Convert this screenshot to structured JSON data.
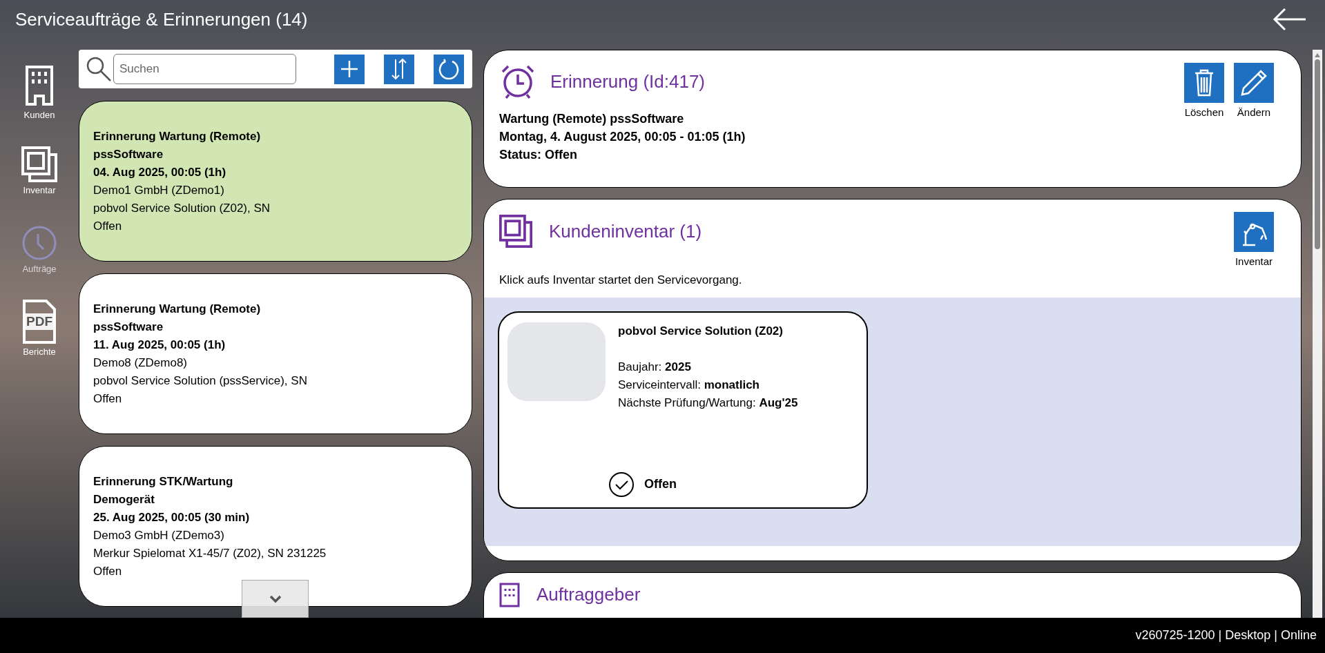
{
  "header": {
    "title": "Serviceaufträge & Erinnerungen (14)"
  },
  "sidebar": {
    "items": [
      {
        "label": "Kunden",
        "selected": false
      },
      {
        "label": "Inventar",
        "selected": false
      },
      {
        "label": "Aufträge",
        "selected": true
      },
      {
        "label": "Berichte",
        "selected": false,
        "icon_text": "PDF"
      }
    ]
  },
  "search": {
    "placeholder": "Suchen"
  },
  "list": {
    "items": [
      {
        "title": "Erinnerung Wartung (Remote)",
        "subject": "pssSoftware",
        "date": "04. Aug 2025, 00:05 (1h)",
        "customer": "Demo1 GmbH (ZDemo1)",
        "device": "pobvol Service Solution (Z02), SN",
        "status": "Offen",
        "selected": true
      },
      {
        "title": "Erinnerung Wartung (Remote)",
        "subject": "pssSoftware",
        "date": "11. Aug 2025, 00:05 (1h)",
        "customer": "Demo8 (ZDemo8)",
        "device": "pobvol Service Solution (pssService), SN",
        "status": "Offen",
        "selected": false
      },
      {
        "title": "Erinnerung STK/Wartung",
        "subject": "Demogerät",
        "date": "25. Aug 2025, 00:05 (30 min)",
        "customer": "Demo3 GmbH (ZDemo3)",
        "device": "Merkur Spielomat X1-45/7 (Z02), SN 231225",
        "status": "Offen",
        "selected": false
      }
    ]
  },
  "reminder": {
    "title": "Erinnerung (Id:417)",
    "lines": [
      "Wartung (Remote) pssSoftware",
      "Montag, 4. August 2025, 00:05 - 01:05 (1h)",
      "Status: Offen"
    ],
    "actions": [
      "Löschen",
      "Ändern"
    ]
  },
  "inventory": {
    "title": "Kundeninventar (1)",
    "action": "Inventar",
    "hint": "Klick aufs Inventar startet den Servicevorgang.",
    "items": [
      {
        "name": "pobvol Service Solution (Z02)",
        "fields": [
          "Baujahr: **2025**",
          "Serviceintervall: **monatlich**",
          "Nächste Prüfung/Wartung: **Aug'25**"
        ],
        "status": "Offen"
      }
    ]
  },
  "client": {
    "title": "Auftraggeber"
  },
  "status_bar": {
    "text": "v260725-1200 | Desktop | Online"
  }
}
